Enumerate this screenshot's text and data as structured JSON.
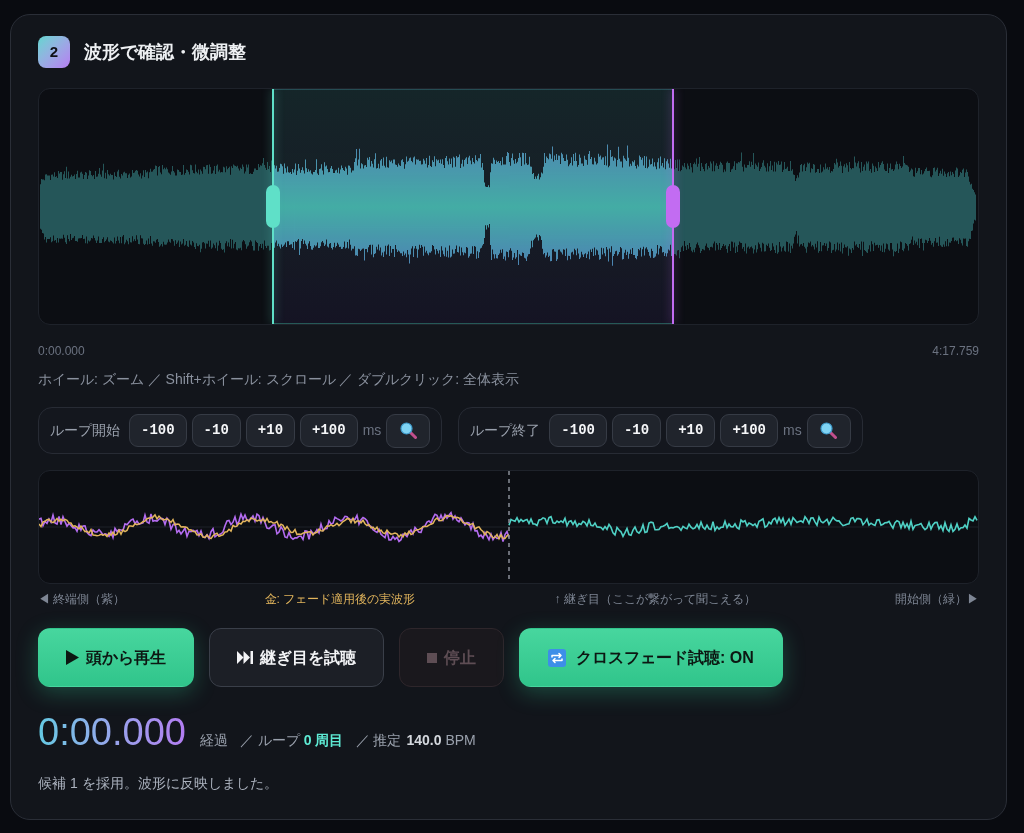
{
  "section": {
    "number": "2",
    "title": "波形で確認・微調整"
  },
  "waveform": {
    "loop_handles": [
      {
        "kind": "start",
        "level": 0.249
      },
      {
        "kind": "end",
        "level": 0.675
      }
    ],
    "start_time": "0:00.000",
    "end_time": "4:17.759"
  },
  "hint": "ホイール: ズーム ／ Shift+ホイール: スクロール ／ ダブルクリック: 全体表示",
  "nudge_groups": [
    {
      "label": "ループ開始",
      "buttons": [
        "-100",
        "-10",
        "+10",
        "+100"
      ],
      "unit": "ms"
    },
    {
      "label": "ループ終了",
      "buttons": [
        "-100",
        "-10",
        "+10",
        "+100"
      ],
      "unit": "ms"
    }
  ],
  "seam_legend": [
    {
      "text": "◀ 終端側（紫）",
      "color": "#7e8694"
    },
    {
      "text": "金: フェード適用後の実波形",
      "color": "#e2b55c"
    },
    {
      "text": "↑ 継ぎ目（ここが繋がって聞こえる）",
      "color": "#7e8694"
    },
    {
      "text": "開始側（緑）▶",
      "color": "#7e8694"
    }
  ],
  "transport_buttons": [
    {
      "kind": "play",
      "label": "頭から再生",
      "disabled": false
    },
    {
      "kind": "seam",
      "label": "継ぎ目を試聴",
      "disabled": false
    },
    {
      "kind": "stop",
      "label": "停止",
      "disabled": true
    }
  ],
  "crossfade_toggle": {
    "label": "クロスフェード試聴: ON",
    "on": true
  },
  "playback": {
    "time": "0:00.000",
    "elapsed_label": "経過",
    "loop_label": "／ ループ",
    "loop_count": "0 周目",
    "bpm_label": "／ 推定",
    "bpm_value": "140.0",
    "bpm_unit": "BPM"
  },
  "message": "候補 1 を採用。波形に反映しました。"
}
